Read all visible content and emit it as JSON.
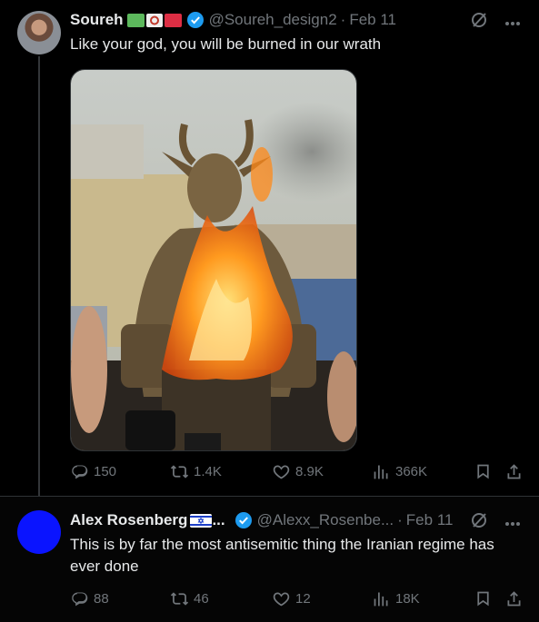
{
  "tweets": [
    {
      "author_name": "Soureh",
      "handle": "@Soureh_design2",
      "dot": "·",
      "date": "Feb 11",
      "text": "Like your god, you will be burned in our wrath",
      "actions": {
        "replies": "150",
        "reposts": "1.4K",
        "likes": "8.9K",
        "views": "366K"
      },
      "media_description": "statue of horned figure on fire"
    },
    {
      "author_name": "Alex Rosenberg",
      "name_ellipsis": "...",
      "handle": "@Alexx_Rosenbe...",
      "dot": "·",
      "date": "Feb 11",
      "text": "This is by far the most antisemitic thing the Iranian regime has ever done",
      "actions": {
        "replies": "88",
        "reposts": "46",
        "likes": "12",
        "views": "18K"
      }
    }
  ],
  "colors": {
    "background": "#000000",
    "text": "#e7e9ea",
    "muted": "#71767b",
    "verified": "#1d9bf0",
    "avatar2": "#0a14ff"
  },
  "icons": [
    "verified-badge-icon",
    "grok-icon",
    "more-icon",
    "reply-icon",
    "repost-icon",
    "like-icon",
    "views-icon",
    "bookmark-icon",
    "share-icon"
  ]
}
